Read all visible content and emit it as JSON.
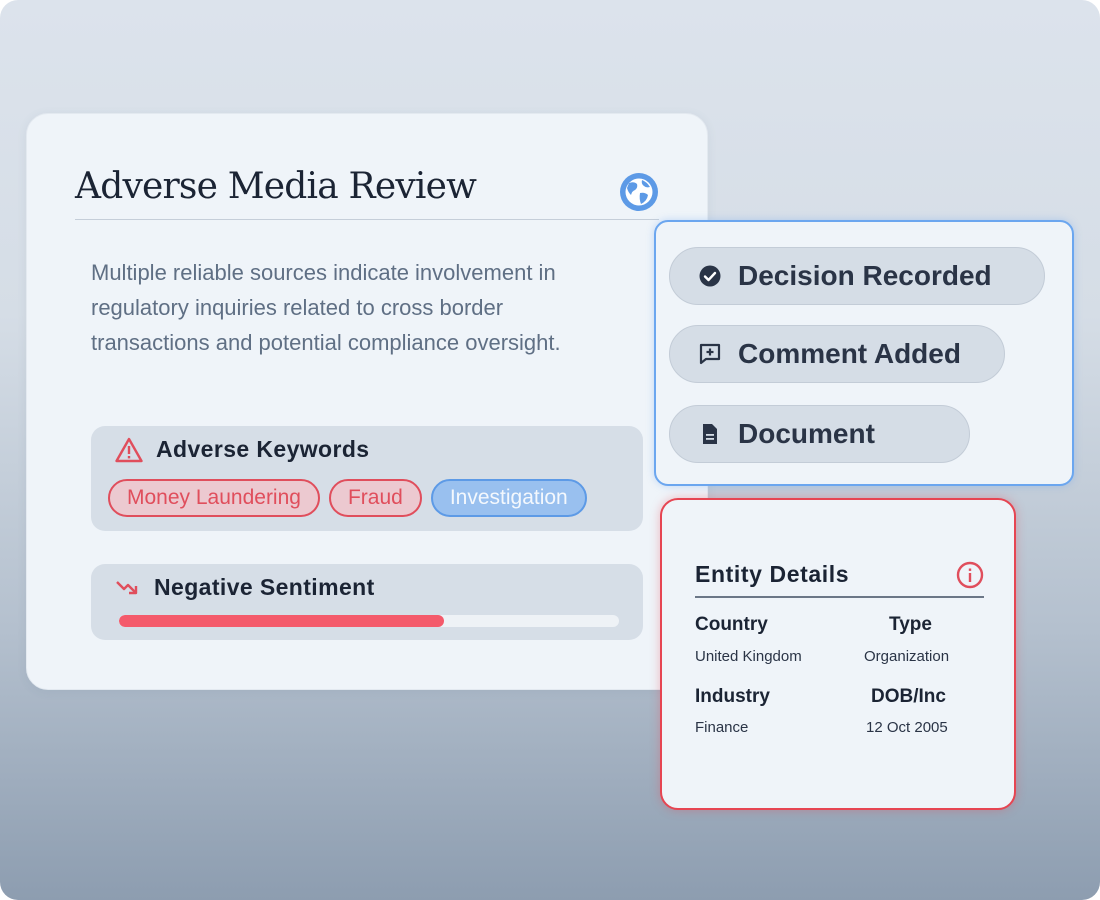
{
  "review": {
    "title": "Adverse Media Review",
    "description": "Multiple reliable sources indicate involvement in regulatory inquiries related to cross border transactions and potential compliance oversight.",
    "keywords": {
      "heading": "Adverse Keywords",
      "chips": [
        "Money Laundering",
        "Fraud",
        "Investigation"
      ]
    },
    "sentiment": {
      "heading": "Negative Sentiment",
      "level": 0.65
    }
  },
  "activity": {
    "items": [
      "Decision Recorded",
      "Comment Added",
      "Document"
    ]
  },
  "entity": {
    "title": "Entity Details",
    "fields": [
      {
        "label": "Country",
        "value": "United Kingdom"
      },
      {
        "label": "Type",
        "value": "Organization"
      },
      {
        "label": "Industry",
        "value": "Finance"
      },
      {
        "label": "DOB/Inc",
        "value": "12 Oct 2005"
      }
    ]
  },
  "colors": {
    "accent_blue": "#5d9ae6",
    "alert_red": "#e04e5c",
    "sentiment_fill": "#f45a6b"
  },
  "icons": [
    "globe-icon",
    "warning-icon",
    "trend-down-icon",
    "check-circle-icon",
    "comment-plus-icon",
    "document-icon",
    "info-icon"
  ]
}
